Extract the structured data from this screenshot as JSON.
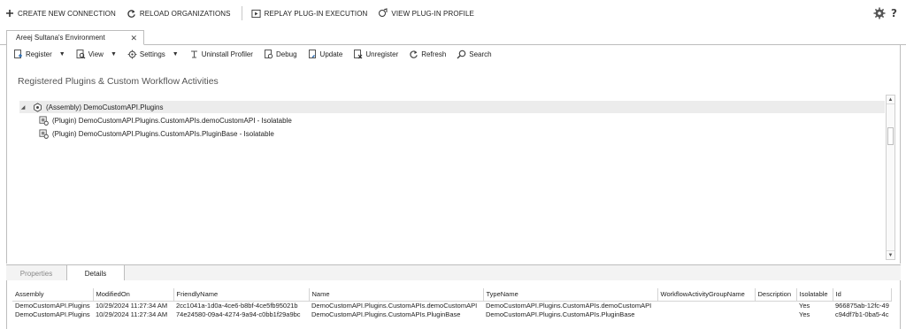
{
  "toolbar": {
    "create_connection": "CREATE NEW CONNECTION",
    "reload_orgs": "RELOAD ORGANIZATIONS",
    "replay": "REPLAY PLUG-IN EXECUTION",
    "view_profile": "VIEW PLUG-IN PROFILE",
    "help": "?"
  },
  "env_tab": {
    "label": "Areej Sultana's Environment",
    "close": "✕"
  },
  "commands": {
    "register": "Register",
    "view": "View",
    "settings": "Settings",
    "uninstall_profiler": "Uninstall Profiler",
    "debug": "Debug",
    "update": "Update",
    "unregister": "Unregister",
    "refresh": "Refresh",
    "search": "Search"
  },
  "heading": "Registered Plugins & Custom Workflow Activities",
  "tree": {
    "assembly": "(Assembly) DemoCustomAPI.Plugins",
    "plugins": [
      "(Plugin) DemoCustomAPI.Plugins.CustomAPIs.demoCustomAPI - Isolatable",
      "(Plugin) DemoCustomAPI.Plugins.CustomAPIs.PluginBase - Isolatable"
    ]
  },
  "bottom_tabs": {
    "properties": "Properties",
    "details": "Details"
  },
  "grid": {
    "columns": [
      "Assembly",
      "ModifiedOn",
      "FriendlyName",
      "Name",
      "TypeName",
      "WorkflowActivityGroupName",
      "Description",
      "Isolatable",
      "Id"
    ],
    "rows": [
      [
        "DemoCustomAPI.Plugins",
        "10/29/2024 11:27:34 AM",
        "2cc1041a-1d0a-4ce6-b8bf-4ce5fb95021b",
        "DemoCustomAPI.Plugins.CustomAPIs.demoCustomAPI",
        "DemoCustomAPI.Plugins.CustomAPIs.demoCustomAPI",
        "",
        "",
        "Yes",
        "966875ab-12fc-49"
      ],
      [
        "DemoCustomAPI.Plugins",
        "10/29/2024 11:27:34 AM",
        "74e24580-09a4-4274-9a94-c0bb1f29a9bc",
        "DemoCustomAPI.Plugins.CustomAPIs.PluginBase",
        "DemoCustomAPI.Plugins.CustomAPIs.PluginBase",
        "",
        "",
        "Yes",
        "c94df7b1-0ba5-4c"
      ]
    ]
  }
}
